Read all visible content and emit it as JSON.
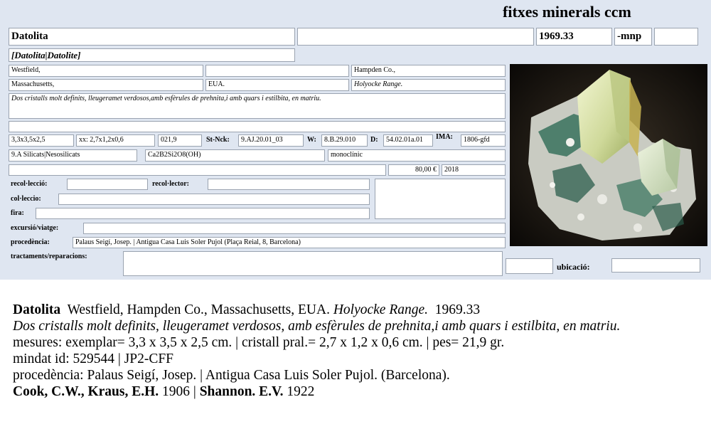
{
  "header": {
    "title": "fitxes minerals ccm"
  },
  "card": {
    "name": "Datolita",
    "name_alt": "",
    "reference": "1969.33",
    "suffix": "-mnp",
    "suffix_extra": "",
    "synonyms": "[Datolita|Datolite]",
    "locality1": "Westfield,",
    "locality1_mid": "",
    "county": "Hampden Co.,",
    "state": "Massachusetts,",
    "country": "EUA.",
    "range": "Holyocke Range.",
    "description": "Dos cristalls molt definits, lleugeramet verdosos,amb esfèrules de prehnita,i amb quars i estilbita, en matriu.",
    "notes": "",
    "size": "3,3x3,5x2,5",
    "crystal": "xx: 2,7x1,2x0,6",
    "weight": "021,9",
    "stnck_label": "St-Nck:",
    "stnck": "9.AJ.20.01_03",
    "w_label": "W:",
    "w": "8.B.29.010",
    "d_label": "D:",
    "d": "54.02.01a.01",
    "ima_label": "IMA:",
    "ima": "1806-gfd",
    "class": "9.A Silicats|Nesosilicats",
    "formula": "Ca2B2Si2O8(OH)",
    "system": "monoclínic",
    "extra_row": "",
    "price": "80,00 €",
    "year": "2018",
    "recollection_label": "recol·lecció:",
    "recollection": "",
    "recollector_label": "recol·lector:",
    "recollector": "",
    "collection_label": "col·leccio:",
    "collection": "",
    "fair_label": "fira:",
    "fair": "",
    "excursion_label": "excursió/viatge:",
    "excursion": "",
    "provenance_label": "procedència:",
    "provenance": "Palaus Seigí, Josep. | Antigua Casa Luis Soler Pujol (Plaça Reial, 8, Barcelona)",
    "treatments_label": "tractaments/reparacions:",
    "treatments": "",
    "location_label": "ubicació:",
    "location": "",
    "location_pre": ""
  },
  "summary": {
    "name": "Datolita",
    "locality": "Westfield, Hampden Co., Massachusetts, EUA.",
    "range": "Holyocke Range.",
    "reference": "1969.33",
    "description": "Dos cristalls molt definits, lleugeramet verdosos, amb esfèrules de prehnita,i amb quars i estilbita, en matriu.",
    "measures": "mesures: exemplar= 3,3 x 3,5 x 2,5 cm. | cristall pral.= 2,7 x 1,2 x 0,6 cm. | pes= 21,9 gr.",
    "mindat": "mindat id: 529544 | JP2-CFF",
    "provenance": "procedència: Palaus Seigí, Josep. | Antigua Casa Luis Soler Pujol. (Barcelona).",
    "ref1_authors": "Cook, C.W., Kraus, E.H.",
    "ref1_year": "1906",
    "ref_sep": "|",
    "ref2_authors": "Shannon. E.V.",
    "ref2_year": "1922"
  }
}
